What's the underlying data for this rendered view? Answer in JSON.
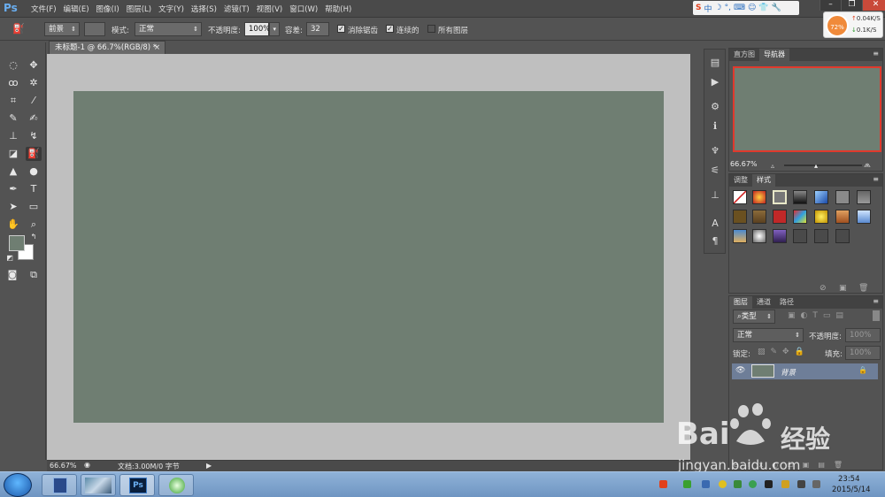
{
  "app": {
    "logo": "Ps"
  },
  "menu": [
    "文件(F)",
    "编辑(E)",
    "图像(I)",
    "图层(L)",
    "文字(Y)",
    "选择(S)",
    "滤镜(T)",
    "视图(V)",
    "窗口(W)",
    "帮助(H)"
  ],
  "sogou": {
    "label": "中"
  },
  "speed": {
    "percent": "72%",
    "up": "0.04K/S",
    "down": "0.1K/S"
  },
  "options": {
    "fill_source": "前景",
    "mode_label": "模式:",
    "mode_value": "正常",
    "opacity_label": "不透明度:",
    "opacity_value": "100%",
    "tolerance_label": "容差:",
    "tolerance_value": "32",
    "antialias_label": "消除锯齿",
    "contiguous_label": "连续的",
    "all_layers_label": "所有图层"
  },
  "document": {
    "tab_title": "未标题-1 @ 66.7%(RGB/8) *",
    "zoom": "66.67%",
    "doc_info": "文档:3.00M/0 字节",
    "canvas_color": "#6f7e72"
  },
  "navigator": {
    "tabs": [
      "直方图",
      "导航器"
    ],
    "zoom": "66.67%"
  },
  "styles": {
    "tabs": [
      "调整",
      "样式"
    ]
  },
  "layers": {
    "tabs": [
      "图层",
      "通道",
      "路径"
    ],
    "filter_label": "类型",
    "blend_mode": "正常",
    "opacity_label": "不透明度:",
    "opacity_value": "100%",
    "lock_label": "锁定:",
    "fill_label": "填充:",
    "fill_value": "100%",
    "layer_name": "背景"
  },
  "foreground_color": "#6f7e72",
  "background_color": "#ffffff",
  "taskbar": {
    "time": "23:54",
    "date": "2015/5/14",
    "ps_label": "Ps"
  },
  "watermark": {
    "brand": "Bai",
    "brand2": "经验",
    "url": "jingyan.baidu.com"
  }
}
